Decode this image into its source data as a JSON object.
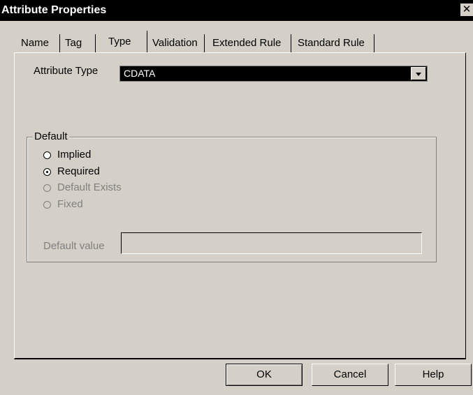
{
  "window": {
    "title": "Attribute Properties",
    "close_label": "✕"
  },
  "tabs": [
    {
      "label": "Name",
      "active": false
    },
    {
      "label": "Tag",
      "active": false
    },
    {
      "label": "Type",
      "active": true
    },
    {
      "label": "Validation",
      "active": false
    },
    {
      "label": "Extended Rule",
      "active": false
    },
    {
      "label": "Standard Rule",
      "active": false
    }
  ],
  "attribute_type": {
    "label": "Attribute Type",
    "value": "CDATA"
  },
  "default_group": {
    "label": "Default",
    "options": [
      {
        "label": "Implied",
        "checked": false,
        "enabled": true
      },
      {
        "label": "Required",
        "checked": true,
        "enabled": true
      },
      {
        "label": "Default Exists",
        "checked": false,
        "enabled": false
      },
      {
        "label": "Fixed",
        "checked": false,
        "enabled": false
      }
    ],
    "default_value_label": "Default value",
    "default_value": ""
  },
  "buttons": {
    "ok": "OK",
    "cancel": "Cancel",
    "help": "Help"
  }
}
